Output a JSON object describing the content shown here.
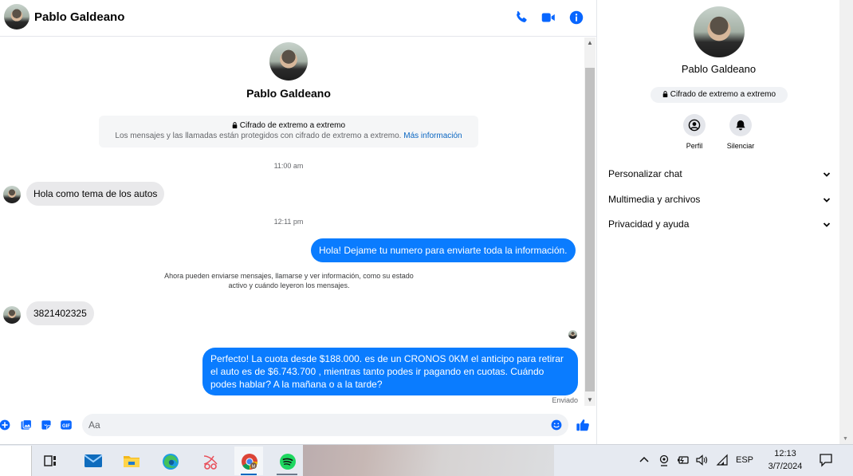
{
  "header": {
    "contact_name": "Pablo Galdeano"
  },
  "profile": {
    "name": "Pablo Galdeano"
  },
  "encryption": {
    "title": "Cifrado de extremo a extremo",
    "text": "Los mensajes y las llamadas están protegidos con cifrado de extremo a extremo.",
    "link": "Más información"
  },
  "messages": {
    "ts1": "11:00 am",
    "msg1": "Hola como tema de los autos",
    "ts2": "12:11 pm",
    "msg2": "Hola! Dejame tu numero  para enviarte toda la información.",
    "notice_line1": "Ahora pueden enviarse mensajes, llamarse y ver información, como su estado",
    "notice_line2": "activo y cuándo leyeron los mensajes.",
    "msg3": "3821402325",
    "msg4": "Perfecto! La cuota desde $188.000. es de un CRONOS 0KM el anticipo para retirar el auto es de $6.743.700 , mientras tanto podes ir pagando en cuotas. Cuándo podes hablar? A la mañana o a la tarde?",
    "sent_status": "Enviado"
  },
  "composer": {
    "placeholder": "Aa"
  },
  "info_panel": {
    "name": "Pablo Galdeano",
    "badge": "Cifrado de extremo a extremo",
    "actions": {
      "perfil": "Perfil",
      "silenciar": "Silenciar"
    },
    "sections": {
      "personalizar": "Personalizar chat",
      "multimedia": "Multimedia y archivos",
      "privacidad": "Privacidad y ayuda"
    }
  },
  "taskbar": {
    "language": "ESP",
    "time": "12:13",
    "date": "3/7/2024"
  },
  "colors": {
    "accent": "#0a7cff",
    "icon_blue": "#0866ff"
  }
}
